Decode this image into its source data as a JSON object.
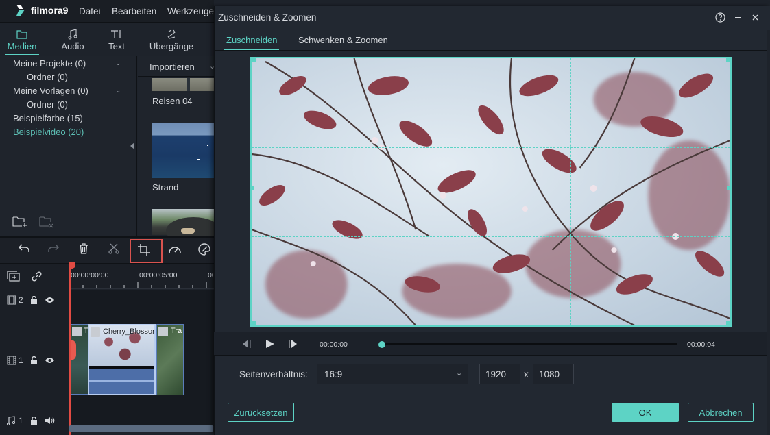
{
  "app": {
    "name": "filmora9",
    "menu": [
      "Datei",
      "Bearbeiten",
      "Werkzeuge"
    ]
  },
  "media_tabs": [
    {
      "label": "Medien",
      "icon": "folder-icon",
      "active": true
    },
    {
      "label": "Audio",
      "icon": "music-note-icon",
      "active": false
    },
    {
      "label": "Text",
      "icon": "text-icon",
      "active": false
    },
    {
      "label": "Übergänge",
      "icon": "transition-icon",
      "active": false
    }
  ],
  "library": {
    "items": [
      {
        "label": "Meine Projekte (0)",
        "level": 0,
        "expandable": true
      },
      {
        "label": "Ordner (0)",
        "level": 1
      },
      {
        "label": "Meine Vorlagen (0)",
        "level": 0,
        "expandable": true
      },
      {
        "label": "Ordner (0)",
        "level": 1
      },
      {
        "label": "Beispielfarbe (15)",
        "level": 0
      },
      {
        "label": "Beispielvideo (20)",
        "level": 0,
        "active": true
      }
    ],
    "add_folder_icon": "folder-add-icon",
    "delete_folder_icon": "folder-delete-icon"
  },
  "media": {
    "import_label": "Importieren",
    "items": [
      {
        "label": "Reisen 04"
      },
      {
        "label": "Strand"
      },
      {
        "label": ""
      }
    ]
  },
  "toolbar": {
    "buttons": [
      "undo-icon",
      "redo-icon",
      "delete-icon",
      "cut-icon",
      "crop-icon",
      "speed-icon",
      "color-icon"
    ],
    "highlighted": "crop-icon"
  },
  "timeline": {
    "ruler": [
      "00:00:00:00",
      "00:00:05:00",
      "00"
    ],
    "tracks": [
      {
        "type": "video",
        "number": "2"
      },
      {
        "type": "video",
        "number": "1"
      },
      {
        "type": "audio",
        "number": "1"
      }
    ],
    "clips": [
      {
        "label": "T"
      },
      {
        "label": "Cherry_Blossom"
      },
      {
        "label": "Tra"
      }
    ]
  },
  "dialog": {
    "title": "Zuschneiden & Zoomen",
    "tabs": [
      {
        "label": "Zuschneiden",
        "active": true
      },
      {
        "label": "Schwenken & Zoomen",
        "active": false
      }
    ],
    "playback": {
      "current_time": "00:00:00",
      "end_time": "00:00:04",
      "progress": 0
    },
    "aspect_label": "Seitenverhältnis:",
    "aspect_value": "16:9",
    "width": "1920",
    "height": "1080",
    "x_separator": "x",
    "reset_label": "Zurücksetzen",
    "ok_label": "OK",
    "cancel_label": "Abbrechen",
    "accent": "#5dd3c5"
  }
}
